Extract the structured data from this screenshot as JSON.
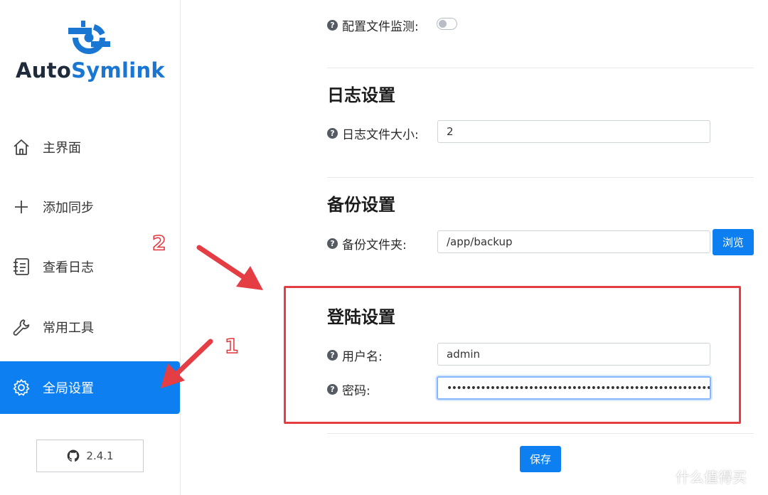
{
  "app": {
    "logo_text_part1": "Auto",
    "logo_text_part2": "Symlink",
    "brand_color": "#1976d2"
  },
  "sidebar": {
    "items": [
      {
        "label": "主界面",
        "icon": "home-icon"
      },
      {
        "label": "添加同步",
        "icon": "plus-icon"
      },
      {
        "label": "查看日志",
        "icon": "notebook-icon"
      },
      {
        "label": "常用工具",
        "icon": "wrench-icon"
      },
      {
        "label": "全局设置",
        "icon": "gear-icon",
        "active": true
      }
    ],
    "active_color": "#0d7ff0",
    "version_label": "2.4.1",
    "version_icon": "github-icon"
  },
  "settings": {
    "config_watch": {
      "label": "配置文件监测:",
      "enabled": false
    },
    "log": {
      "title": "日志设置",
      "size_label": "日志文件大小:",
      "size_value": "2"
    },
    "backup": {
      "title": "备份设置",
      "folder_label": "备份文件夹:",
      "folder_value": "/app/backup",
      "browse_label": "浏览"
    },
    "login": {
      "title": "登陆设置",
      "username_label": "用户名:",
      "username_value": "admin",
      "password_label": "密码:",
      "password_value": "••••••••••••••••••••••••••••••••••••••••••••••••••••••••••••••••••••••••"
    },
    "save_label": "保存"
  },
  "annotations": {
    "step1": "1",
    "step2": "2",
    "color": "#e53d44"
  },
  "watermark": {
    "icon": "值",
    "text": "什么值得买"
  }
}
